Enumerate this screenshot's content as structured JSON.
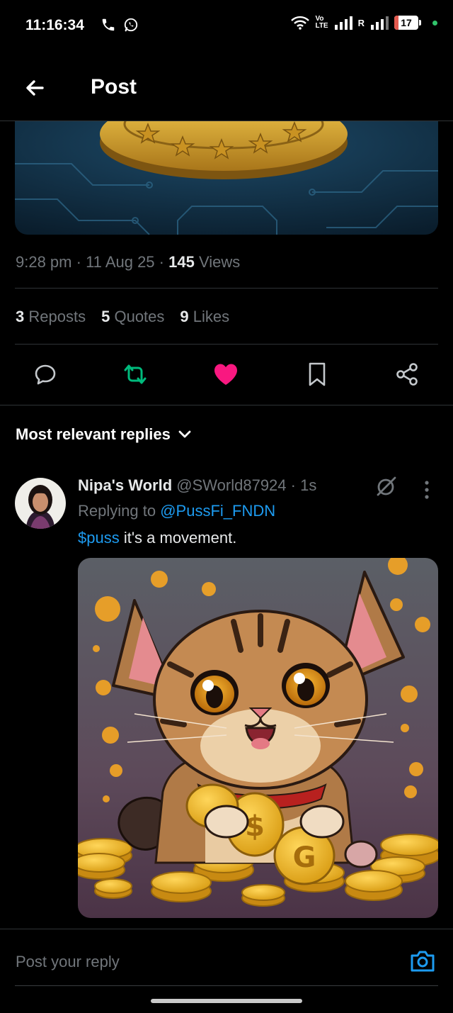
{
  "status_bar": {
    "time": "11:16:34",
    "network_label_top": "Vo",
    "network_label_bottom": "LTE",
    "roaming": "R",
    "battery": "17",
    "battery_level": 0.17
  },
  "header": {
    "title": "Post"
  },
  "post": {
    "time": "9:28 pm",
    "date": "11 Aug 25",
    "views_count": "145",
    "views_label": "Views",
    "reposts_count": "3",
    "reposts_label": "Reposts",
    "quotes_count": "5",
    "quotes_label": "Quotes",
    "likes_count": "9",
    "likes_label": "Likes"
  },
  "replies": {
    "sort_label": "Most relevant replies",
    "items": [
      {
        "display_name": "Nipa's World",
        "handle": "@SWorld87924",
        "age": "1s",
        "replying_prefix": "Replying to",
        "replying_to": "@PussFi_FNDN",
        "cashtag": "$puss",
        "text": " it's a movement."
      }
    ]
  },
  "compose": {
    "placeholder": "Post your reply"
  },
  "colors": {
    "accent": "#1d9bf0",
    "like": "#f91880",
    "repost": "#00ba7c",
    "muted": "#71767b"
  }
}
